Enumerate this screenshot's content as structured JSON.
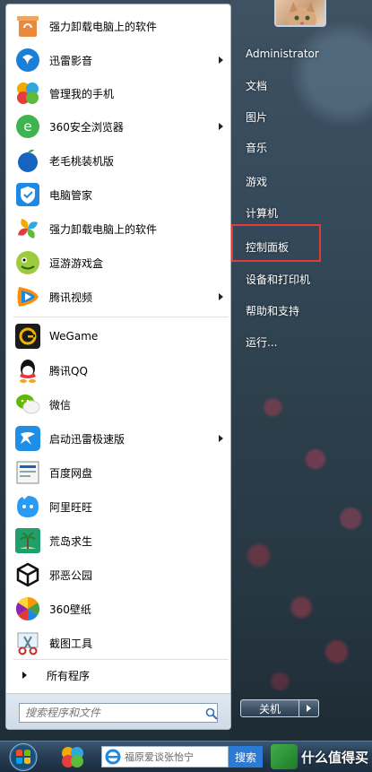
{
  "programs": [
    {
      "label": "强力卸载电脑上的软件",
      "icon": "uninstall-icon",
      "submenu": false
    },
    {
      "label": "迅雷影音",
      "icon": "xunlei-player-icon",
      "submenu": true
    },
    {
      "label": "管理我的手机",
      "icon": "phone-manager-icon",
      "submenu": false
    },
    {
      "label": "360安全浏览器",
      "icon": "360-browser-icon",
      "submenu": true
    },
    {
      "label": "老毛桃装机版",
      "icon": "laomaotao-icon",
      "submenu": false
    },
    {
      "label": "电脑管家",
      "icon": "pc-manager-icon",
      "submenu": false
    },
    {
      "label": "强力卸载电脑上的软件",
      "icon": "uninstall-pinwheel-icon",
      "submenu": false
    },
    {
      "label": "逗游游戏盒",
      "icon": "douyou-game-icon",
      "submenu": false
    },
    {
      "label": "腾讯视频",
      "icon": "tencent-video-icon",
      "submenu": true
    },
    {
      "label": "WeGame",
      "icon": "wegame-icon",
      "submenu": false
    },
    {
      "label": "腾讯QQ",
      "icon": "qq-icon",
      "submenu": false
    },
    {
      "label": "微信",
      "icon": "wechat-icon",
      "submenu": false
    },
    {
      "label": "启动迅雷极速版",
      "icon": "xunlei-icon",
      "submenu": true
    },
    {
      "label": "百度网盘",
      "icon": "baidu-netdisk-icon",
      "submenu": false
    },
    {
      "label": "阿里旺旺",
      "icon": "aliwangwang-icon",
      "submenu": false
    },
    {
      "label": "荒岛求生",
      "icon": "island-survival-icon",
      "submenu": false
    },
    {
      "label": "邪恶公园",
      "icon": "unity-icon",
      "submenu": false
    },
    {
      "label": "360壁纸",
      "icon": "360-wallpaper-icon",
      "submenu": false
    },
    {
      "label": "截图工具",
      "icon": "snipping-tool-icon",
      "submenu": false
    }
  ],
  "all_programs_label": "所有程序",
  "search": {
    "placeholder": "搜索程序和文件"
  },
  "right_links": [
    {
      "label": "Administrator",
      "name": "link-administrator"
    },
    {
      "label": "文档",
      "name": "link-documents"
    },
    {
      "label": "图片",
      "name": "link-pictures"
    },
    {
      "label": "音乐",
      "name": "link-music"
    },
    {
      "label": "游戏",
      "name": "link-games"
    },
    {
      "label": "计算机",
      "name": "link-computer"
    },
    {
      "label": "控制面板",
      "name": "link-control-panel"
    },
    {
      "label": "设备和打印机",
      "name": "link-devices-printers"
    },
    {
      "label": "帮助和支持",
      "name": "link-help-support"
    },
    {
      "label": "运行...",
      "name": "link-run"
    }
  ],
  "shutdown_label": "关机",
  "taskbar": {
    "search_placeholder": "福原爱谈张怡宁",
    "search_button": "搜索",
    "watermark": "什么值得买"
  },
  "colors": {
    "highlight": "#e53935",
    "taskbar_search_button": "#2b7ad6"
  }
}
